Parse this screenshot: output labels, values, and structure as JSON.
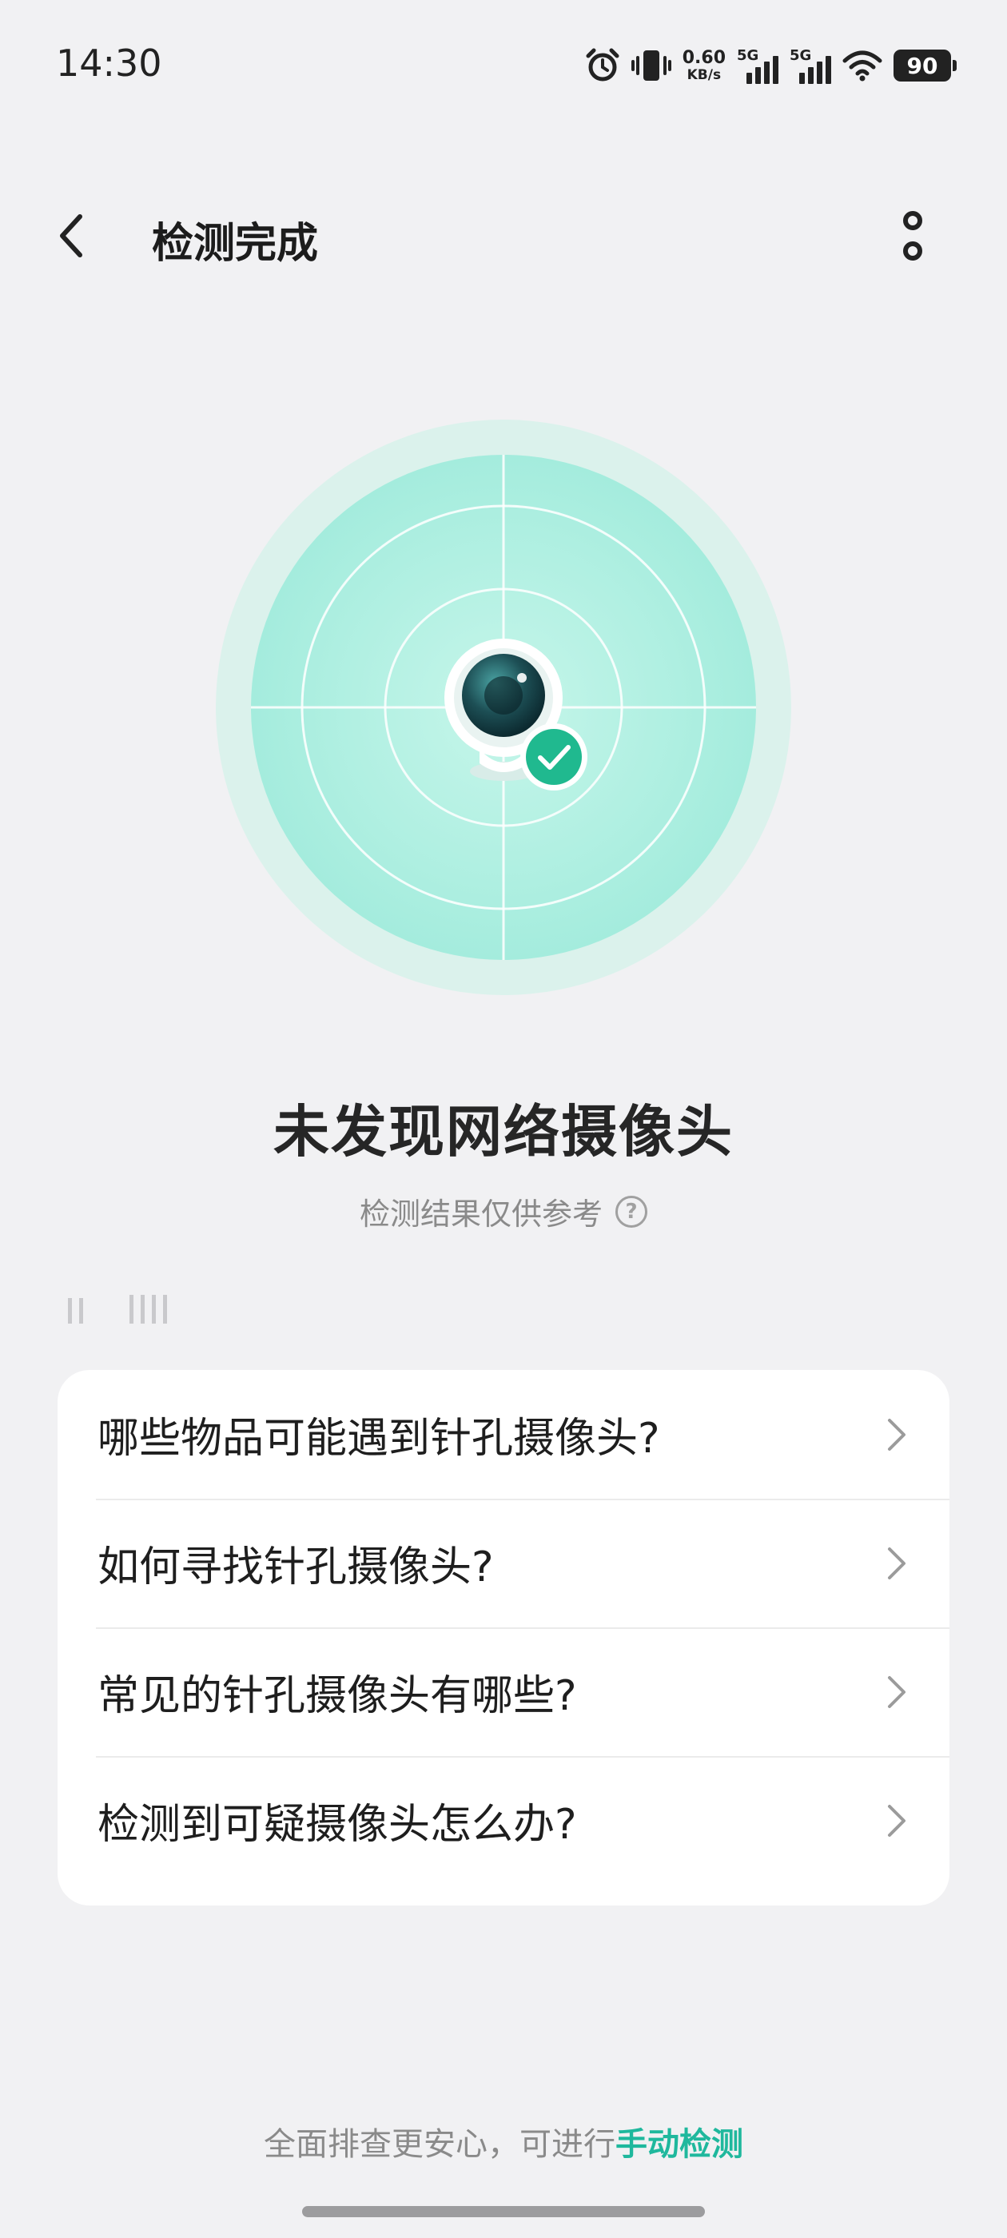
{
  "status_bar": {
    "time": "14:30",
    "net_speed_value": "0.60",
    "net_speed_unit": "KB/s",
    "sim1_label": "5G",
    "sim2_label": "5G",
    "battery_level": "90",
    "icons": [
      "alarm-icon",
      "vibrate-icon",
      "signal-icon",
      "wifi-icon",
      "battery-icon"
    ]
  },
  "header": {
    "title": "检测完成",
    "back_icon": "back-arrow-icon",
    "more_icon": "more-icon"
  },
  "result": {
    "illustration": "camera-radar-icon",
    "title": "未发现网络摄像头",
    "subtitle": "检测结果仅供参考",
    "help_icon_glyph": "?"
  },
  "faq": {
    "items": [
      {
        "label": "哪些物品可能遇到针孔摄像头?"
      },
      {
        "label": "如何寻找针孔摄像头?"
      },
      {
        "label": "常见的针孔摄像头有哪些?"
      },
      {
        "label": "检测到可疑摄像头怎么办?"
      }
    ]
  },
  "footer": {
    "prefix": "全面排查更安心，可进行",
    "link": "手动检测"
  },
  "colors": {
    "accent": "#1fb89d",
    "radar_outer": "#dff3ef",
    "radar_inner": "#a9f0e0",
    "background": "#f1f1f3"
  }
}
